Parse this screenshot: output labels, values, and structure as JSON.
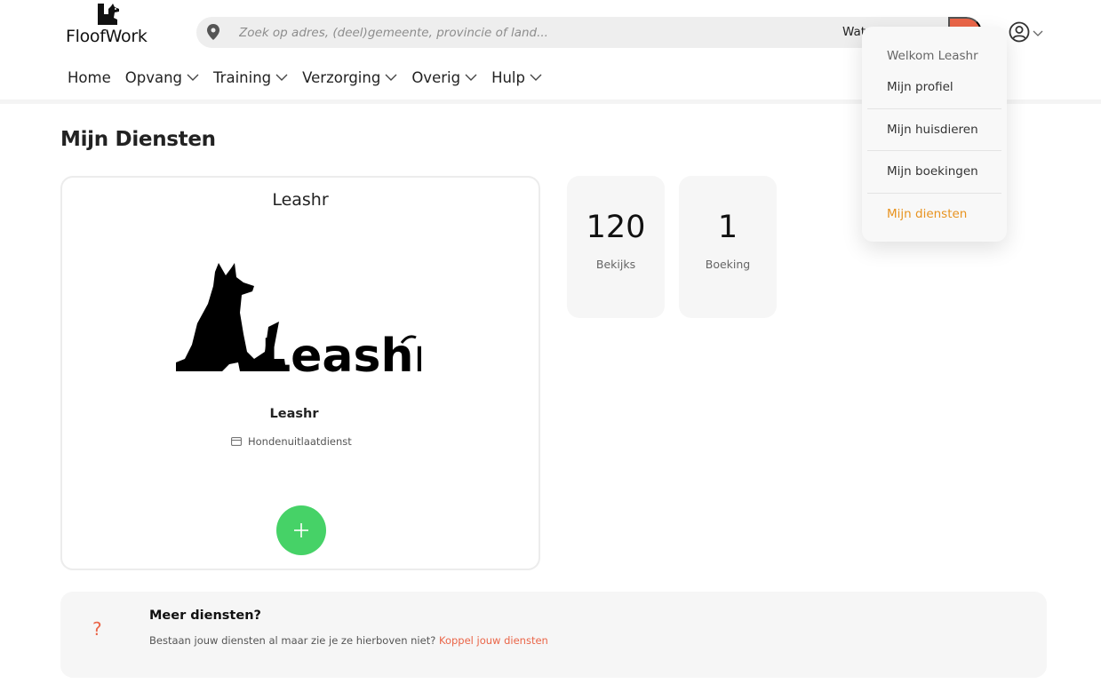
{
  "header": {
    "logo_text": "FloofWork",
    "search": {
      "placeholder": "Zoek op adres, (deel)gemeente, provincie of land...",
      "what_label": "Wat"
    },
    "colors": {
      "accent": "#ea6548",
      "highlight": "#e8931f",
      "success": "#46d267"
    }
  },
  "nav": {
    "items": [
      {
        "label": "Home",
        "has_dropdown": false
      },
      {
        "label": "Opvang",
        "has_dropdown": true
      },
      {
        "label": "Training",
        "has_dropdown": true
      },
      {
        "label": "Verzorging",
        "has_dropdown": true
      },
      {
        "label": "Overig",
        "has_dropdown": true
      },
      {
        "label": "Hulp",
        "has_dropdown": true
      }
    ]
  },
  "user_menu": {
    "greeting": "Welkom Leashr",
    "items": [
      {
        "label": "Mijn profiel"
      },
      {
        "label": "Mijn huisdieren"
      },
      {
        "label": "Mijn boekingen"
      },
      {
        "label": "Mijn diensten",
        "active": true
      }
    ]
  },
  "main": {
    "title": "Mijn Diensten",
    "service_card": {
      "title": "Leashr",
      "logo_text": "Leashr",
      "name": "Leashr",
      "category": "Hondenuitlaatdienst",
      "add_icon": "plus-icon"
    },
    "stats": [
      {
        "value": "120",
        "label": "Bekijks"
      },
      {
        "value": "1",
        "label": "Boeking"
      }
    ],
    "info": {
      "icon": "?",
      "title": "Meer diensten?",
      "text": "Bestaan jouw diensten al maar zie je ze hierboven niet?",
      "link": "Koppel jouw diensten"
    }
  }
}
